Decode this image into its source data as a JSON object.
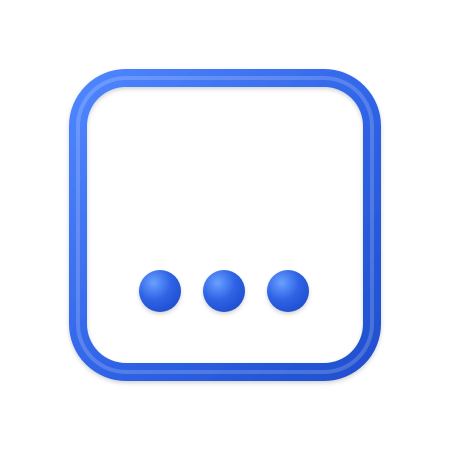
{
  "icon": {
    "name": "more-options-square-icon",
    "label": "",
    "colors": {
      "accent": "#2f63e6",
      "accent_light": "#4f86ff",
      "accent_dark": "#1f4fcf",
      "background": "#ffffff"
    }
  }
}
